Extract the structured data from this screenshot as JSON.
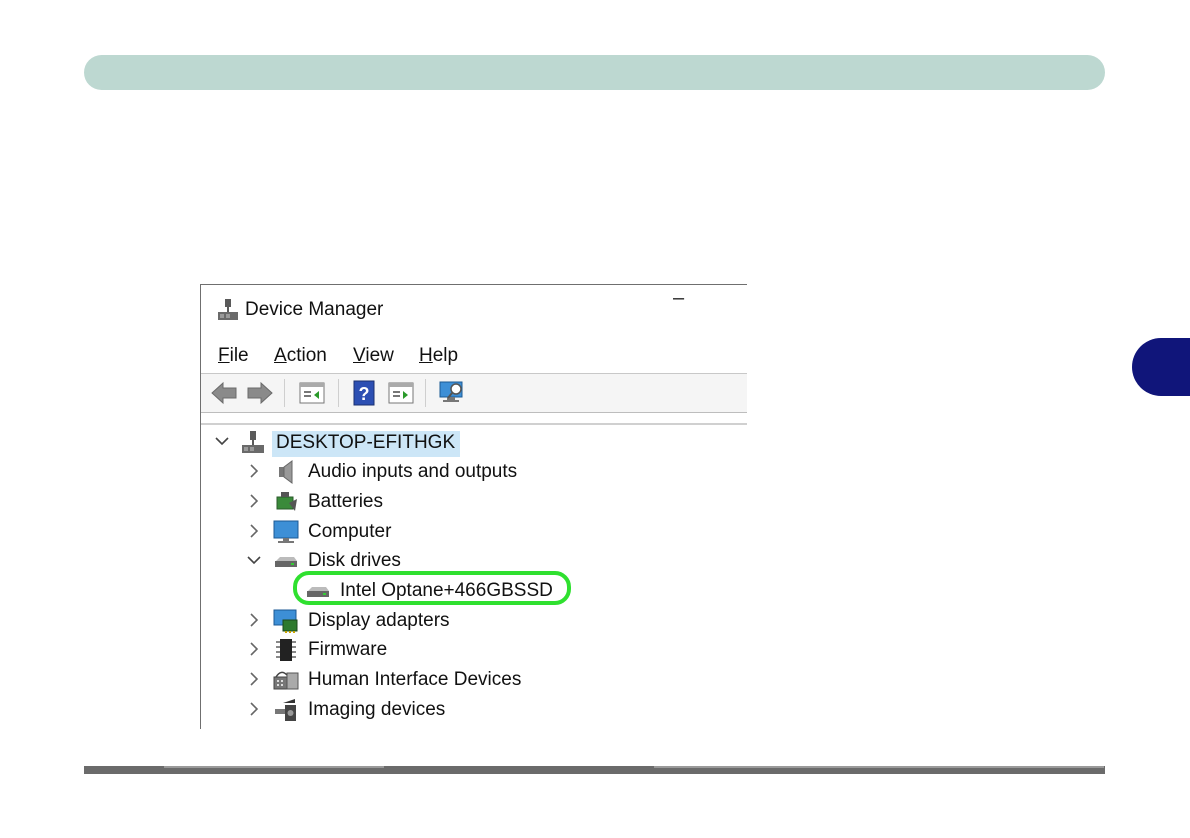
{
  "window": {
    "title": "Device Manager",
    "minimize_glyph": "–"
  },
  "menu": [
    {
      "accel": "F",
      "rest": "ile"
    },
    {
      "accel": "A",
      "rest": "ction"
    },
    {
      "accel": "V",
      "rest": "iew"
    },
    {
      "accel": "H",
      "rest": "elp"
    }
  ],
  "toolbar": [
    "back-icon",
    "forward-icon",
    "properties-icon",
    "help-icon",
    "update-driver-icon",
    "scan-hardware-icon"
  ],
  "tree": {
    "root": "DESKTOP-EFITHGK",
    "items": [
      {
        "label": "Audio inputs and outputs",
        "icon": "speaker-icon",
        "expanded": false
      },
      {
        "label": "Batteries",
        "icon": "battery-icon",
        "expanded": false
      },
      {
        "label": "Computer",
        "icon": "monitor-icon",
        "expanded": false
      },
      {
        "label": "Disk drives",
        "icon": "disk-drive-icon",
        "expanded": true
      },
      {
        "label": "Intel Optane+466GBSSD",
        "icon": "disk-drive-icon",
        "child": true
      },
      {
        "label": "Display adapters",
        "icon": "display-adapter-icon",
        "expanded": false
      },
      {
        "label": "Firmware",
        "icon": "chip-icon",
        "expanded": false
      },
      {
        "label": "Human Interface Devices",
        "icon": "hid-icon",
        "expanded": false
      },
      {
        "label": "Imaging devices",
        "icon": "camera-icon",
        "expanded": false
      }
    ]
  },
  "colors": {
    "header_bar": "#bdd8d1",
    "chapter_tab": "#10157a",
    "highlight": "#2fe02f",
    "selection": "#cce6f7"
  }
}
